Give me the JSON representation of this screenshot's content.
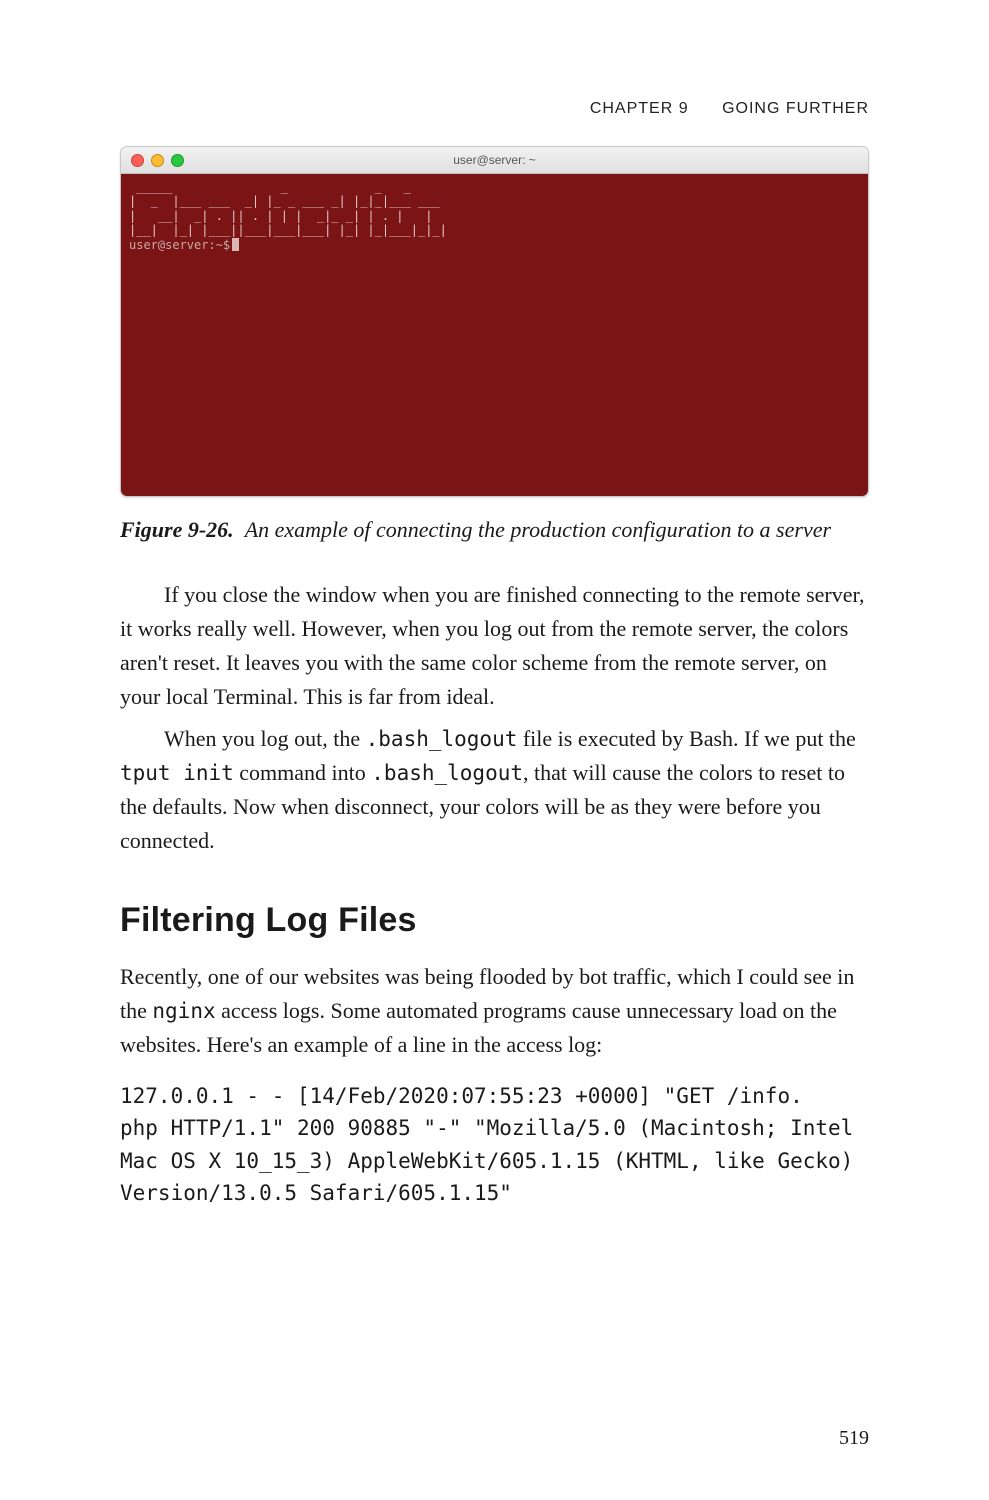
{
  "header": {
    "chapter_label": "CHAPTER 9",
    "chapter_title": "GOING FURTHER"
  },
  "terminal": {
    "window_title": "user@server: ~",
    "ascii_banner": " _____               _            _   _\n|  _  |___ ___  _| |_ _ ___ _| |_|_|___ ___\n|   __|  _| . || . | | |  _|_ _| | . |   |\n|__|  |_| |___||___|___|___| |_| |_|___|_|_|",
    "prompt": "user@server:~$"
  },
  "figure": {
    "label": "Figure 9-26.",
    "caption": "An example of connecting the production configuration to a server"
  },
  "paragraphs": {
    "p1": "If you close the window when you are finished connecting to the remote server, it works really well. However, when you log out from the remote server, the colors aren't reset. It leaves you with the same color scheme from the remote server, on your local Terminal. This is far from ideal.",
    "p2_a": "When you log out, the ",
    "p2_code1": ".bash_logout",
    "p2_b": " file is executed by Bash. If we put the ",
    "p2_code2": "tput init",
    "p2_c": " command into ",
    "p2_code3": ".bash_logout",
    "p2_d": ", that will cause the colors to reset to the defaults. Now when disconnect, your colors will be as they were before you connected."
  },
  "section_heading": "Filtering Log Files",
  "paragraphs2": {
    "p3_a": "Recently, one of our websites was being flooded by bot traffic, which I could see in the ",
    "p3_code1": "nginx",
    "p3_b": " access logs. Some automated programs cause unnecessary load on the websites. Here's an example of a line in the access log:"
  },
  "code_block": "127.0.0.1 - - [14/Feb/2020:07:55:23 +0000] \"GET /info.\nphp HTTP/1.1\" 200 90885 \"-\" \"Mozilla/5.0 (Macintosh; Intel\nMac OS X 10_15_3) AppleWebKit/605.1.15 (KHTML, like Gecko)\nVersion/13.0.5 Safari/605.1.15\"",
  "page_number": "519"
}
